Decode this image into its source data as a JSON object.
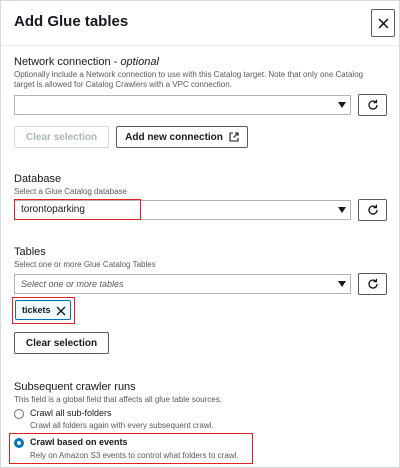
{
  "dialog": {
    "title": "Add Glue tables",
    "close_icon": "close-icon"
  },
  "network": {
    "label": "Network connection - ",
    "label_optional": "optional",
    "description": "Optionally include a Network connection to use with this Catalog target. Note that only one Catalog target is allowed for Catalog Crawlers with a VPC connection.",
    "value": "",
    "clear_label": "Clear selection",
    "add_label": "Add new connection",
    "add_icon": "external-link-icon",
    "refresh_icon": "refresh-icon"
  },
  "database": {
    "label": "Database",
    "description": "Select a Glue Catalog database",
    "value": "torontoparking",
    "refresh_icon": "refresh-icon"
  },
  "tables": {
    "label": "Tables",
    "description": "Select one or more Glue Catalog Tables",
    "placeholder": "Select one or more tables",
    "tokens": [
      "tickets"
    ],
    "clear_label": "Clear selection",
    "refresh_icon": "refresh-icon"
  },
  "subsequent": {
    "label": "Subsequent crawler runs",
    "description": "This field is a global field that affects all glue table sources.",
    "options": [
      {
        "label": "Crawl all sub-folders",
        "description": "Crawl all folders again with every subsequent crawl.",
        "selected": false
      },
      {
        "label": "Crawl based on events",
        "description": "Rely on Amazon S3 events to control what folders to crawl.",
        "selected": true
      }
    ]
  },
  "colors": {
    "highlight": "#e02020",
    "accent": "#0073bb"
  }
}
